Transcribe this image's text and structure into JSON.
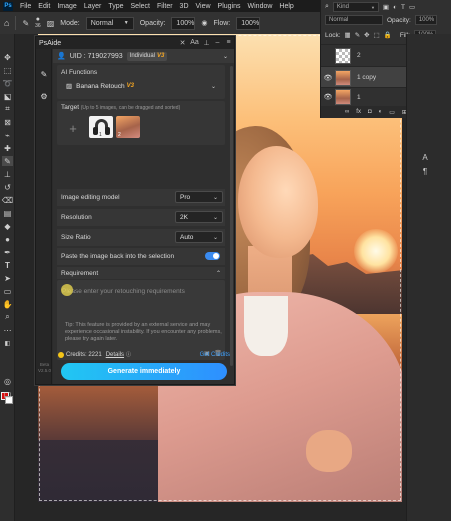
{
  "menubar": {
    "logo": "Ps",
    "items": [
      "File",
      "Edit",
      "Image",
      "Layer",
      "Type",
      "Select",
      "Filter",
      "3D",
      "View",
      "Plugins",
      "Window",
      "Help"
    ]
  },
  "options_bar": {
    "brush_size": "36",
    "mode_label": "Mode:",
    "mode_value": "Normal",
    "opacity_label": "Opacity:",
    "opacity_value": "100%",
    "flow_label": "Flow:",
    "flow_value": "100%"
  },
  "layers_panel": {
    "filter_kind": "Kind",
    "blend_mode": "Normal",
    "opacity_label": "Opacity:",
    "opacity_value": "100%",
    "lock_label": "Lock:",
    "fill_label": "Fill:",
    "fill_value": "100%",
    "layers": [
      {
        "name": "2"
      },
      {
        "name": "1 copy"
      },
      {
        "name": "1"
      }
    ],
    "footer_fx": "fx"
  },
  "plugin": {
    "title": "PsAide",
    "uid": "UID : 719027993",
    "plan": "Individual",
    "plan_version": "V3",
    "ai_functions_label": "AI Functions",
    "function_value": "Banana Retouch",
    "function_version": "V3",
    "target_label": "Target",
    "target_hint": "(Up to 5 images, can be dragged and sorted)",
    "target_images": [
      {
        "index": "1"
      },
      {
        "index": "2"
      }
    ],
    "add_symbol": "+",
    "model_label": "Image editing model",
    "model_value": "Pro",
    "resolution_label": "Resolution",
    "resolution_value": "2K",
    "ratio_label": "Size Ratio",
    "ratio_value": "Auto",
    "paste_back_label": "Paste the image back into the selection",
    "paste_back_enabled": true,
    "requirement_label": "Requirement",
    "requirement_placeholder": "Please enter your retouching requirements",
    "tip": "Tip: This feature is provided by an external service and may experience occasional instability. If you encounter any problems, please try again later.",
    "credits_label": "Credits: 2221",
    "details_label": "Details",
    "get_credits_label": "Get Credits",
    "generate_label": "Generate immediately",
    "beta_label": "Beta",
    "version_label": "V2.5.0"
  },
  "colors": {
    "accent_blue": "#2e8fff",
    "version_orange": "#f5a623",
    "foreground_swatch": "#d41111",
    "background_swatch": "#ffffff"
  }
}
